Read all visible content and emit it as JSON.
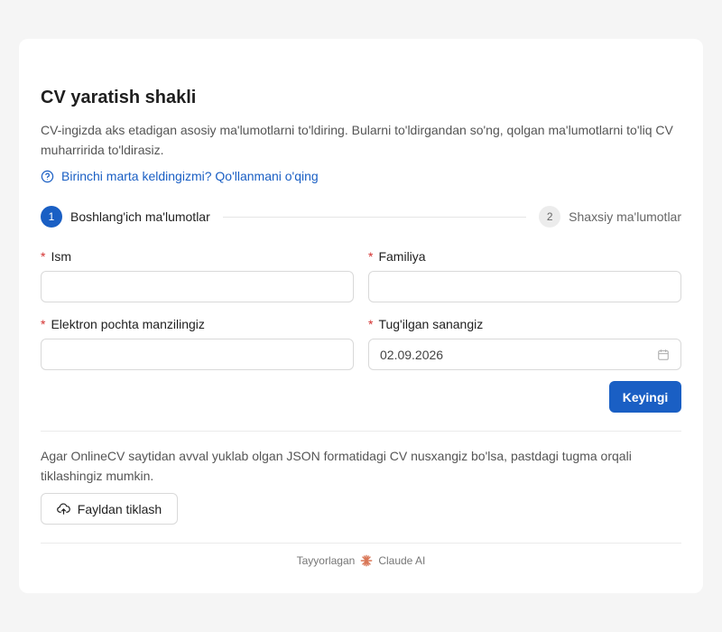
{
  "form": {
    "title": "CV yaratish shakli",
    "description": "CV-ingizda aks etadigan asosiy ma'lumotlarni to'ldiring. Bularni to'ldirgandan so'ng, qolgan ma'lumotlarni to'liq CV muharririda to'ldirasiz.",
    "help_link": "Birinchi marta keldingizmi? Qo'llanmani o'qing"
  },
  "steps": [
    {
      "number": "1",
      "label": "Boshlang'ich ma'lumotlar",
      "active": true
    },
    {
      "number": "2",
      "label": "Shaxsiy ma'lumotlar",
      "active": false
    }
  ],
  "fields": {
    "required_mark": "*",
    "first_name": {
      "label": "Ism",
      "value": ""
    },
    "last_name": {
      "label": "Familiya",
      "value": ""
    },
    "email": {
      "label": "Elektron pochta manzilingiz",
      "value": ""
    },
    "birth_date": {
      "label": "Tug'ilgan sanangiz",
      "value": "02.09.2026"
    }
  },
  "buttons": {
    "next": "Keyingi",
    "restore": "Fayldan tiklash"
  },
  "restore": {
    "text": "Agar OnlineCV saytidan avval yuklab olgan JSON formatidagi CV nusxangiz bo'lsa, pastdagi tugma orqali tiklashingiz mumkin."
  },
  "footer": {
    "prefix": "Tayyorlagan",
    "brand": "Claude AI"
  },
  "colors": {
    "accent": "#1a5fc4",
    "required": "#d3302f",
    "claude_logo": "#d97757"
  },
  "icons": {
    "help": "question-circle-icon",
    "calendar": "calendar-icon",
    "upload": "cloud-upload-icon",
    "claude": "claude-logo-icon"
  }
}
